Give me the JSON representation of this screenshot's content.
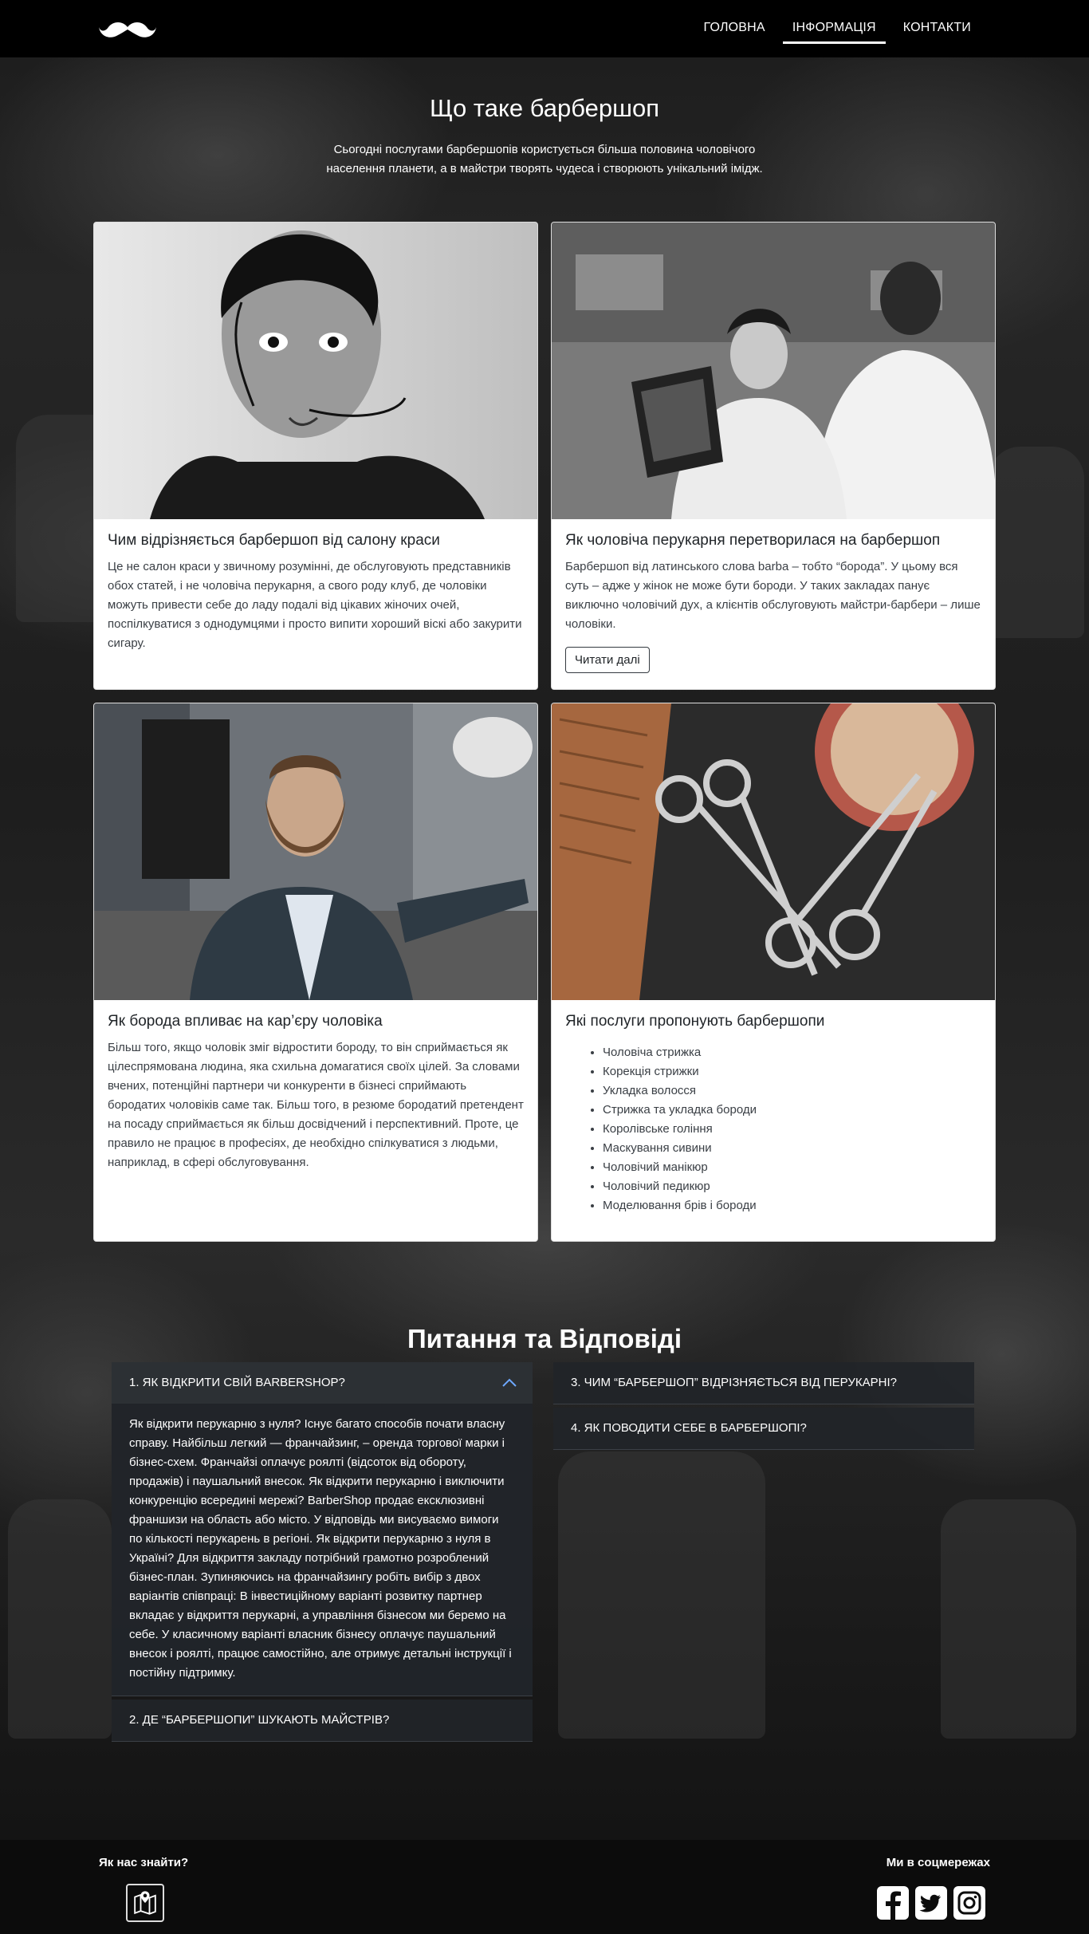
{
  "nav": {
    "items": [
      {
        "label": "ГОЛОВНА",
        "active": false
      },
      {
        "label": "ІНФОРМАЦІЯ",
        "active": true
      },
      {
        "label": "КОНТАКТИ",
        "active": false
      }
    ]
  },
  "intro": {
    "title": "Що таке барбершоп",
    "text": "Сьогодні послугами барбершопів користується більша половина чоловічого населення планети, а в майстри творять чудеса і створюють унікальний імідж."
  },
  "cards": [
    {
      "title": "Чим відрізняється барбершоп від салону краси",
      "text": "Це не салон краси у звичному розумінні, де обслуговують представників обох статей, і не чоловіча перукарня, а свого роду клуб, де чоловіки можуть привести себе до ладу подалі від цікавих жіночих очей, поспілкуватися з однодумцями і просто випити хороший віскі або закурити сигару."
    },
    {
      "title": "Як чоловіча перукарня перетворилася на барбершоп",
      "text": "Барбершоп від латинського слова barba – тобто “борода”. У цьому вся суть – адже у жінок не може бути бороди. У таких закладах панує виключно чоловічий дух, а клієнтів обслуговують майстри-барбери – лише чоловіки.",
      "button": "Читати далі"
    },
    {
      "title": "Як борода впливає на кар’єру чоловіка",
      "text": "Більш того, якщо чоловік зміг відростити бороду, то він сприймається як цілеспрямована людина, яка схильна домагатися своїх цілей. За словами вчених, потенційні партнери чи конкуренти в бізнесі сприймають бородатих чоловіків саме так. Більш того, в резюме бородатий претендент на посаду сприймається як більш досвідчений і перспективний. Проте, це правило не працює в професіях, де необхідно спілкуватися з людьми, наприклад, в сфері обслуговування."
    },
    {
      "title": "Які послуги пропонують барбершопи",
      "list": [
        "Чоловіча стрижка",
        "Корекція стрижки",
        "Укладка волосся",
        "Стрижка та укладка бороди",
        "Королівське гоління",
        "Маскування сивини",
        "Чоловічий манікюр",
        "Чоловічий педикюр",
        "Моделювання брів і бороди"
      ]
    }
  ],
  "faq": {
    "title": "Питання та Відповіді",
    "left": [
      {
        "label": "1. ЯК ВІДКРИТИ СВІЙ BARBERSHOP?",
        "open": true,
        "answer": "Як відкрити перукарню з нуля? Існує багато способів почати власну справу. Найбільш легкий — франчайзинг, – оренда торгової марки і бізнес-схем. Франчайзі оплачує роялті (відсоток від обороту, продажів) і паушальний внесок. Як відкрити перукарню і виключити конкуренцію всередині мережі? BarberShop продає ексклюзивні франшизи на область або місто. У відповідь ми висуваємо вимоги по кількості перукарень в регіоні. Як відкрити перукарню з нуля в Україні? Для відкриття закладу потрібний грамотно розроблений бізнес-план. Зупиняючись на франчайзингу робіть вибір з двох варіантів співпраці: В інвестиційному варіанті розвитку партнер вкладає у відкриття перукарні, а управління бізнесом ми беремо на себе. У класичному варіанті власник бізнесу оплачує паушальний внесок і роялті, працює самостійно, але отримує детальні інструкції і постійну підтримку."
      },
      {
        "label": "2. ДЕ “БАРБЕРШОПИ” ШУКАЮТЬ МАЙСТРІВ?",
        "open": false
      }
    ],
    "right": [
      {
        "label": "3. ЧИМ “БАРБЕРШОП” ВІДРІЗНЯЄТЬСЯ ВІД ПЕРУКАРНІ?",
        "open": false
      },
      {
        "label": "4. ЯК ПОВОДИТИ СЕБЕ В БАРБЕРШОПІ?",
        "open": false
      }
    ]
  },
  "footer": {
    "find_us": "Як нас знайти?",
    "social_title": "Ми в соцмережах",
    "icons": [
      "map-icon",
      "facebook-icon",
      "twitter-icon",
      "instagram-icon"
    ]
  },
  "colors": {
    "header_bg": "#000000",
    "accordion_bg": "#212529",
    "footer_bg": "#0c0c0c",
    "card_bg": "#ffffff"
  }
}
